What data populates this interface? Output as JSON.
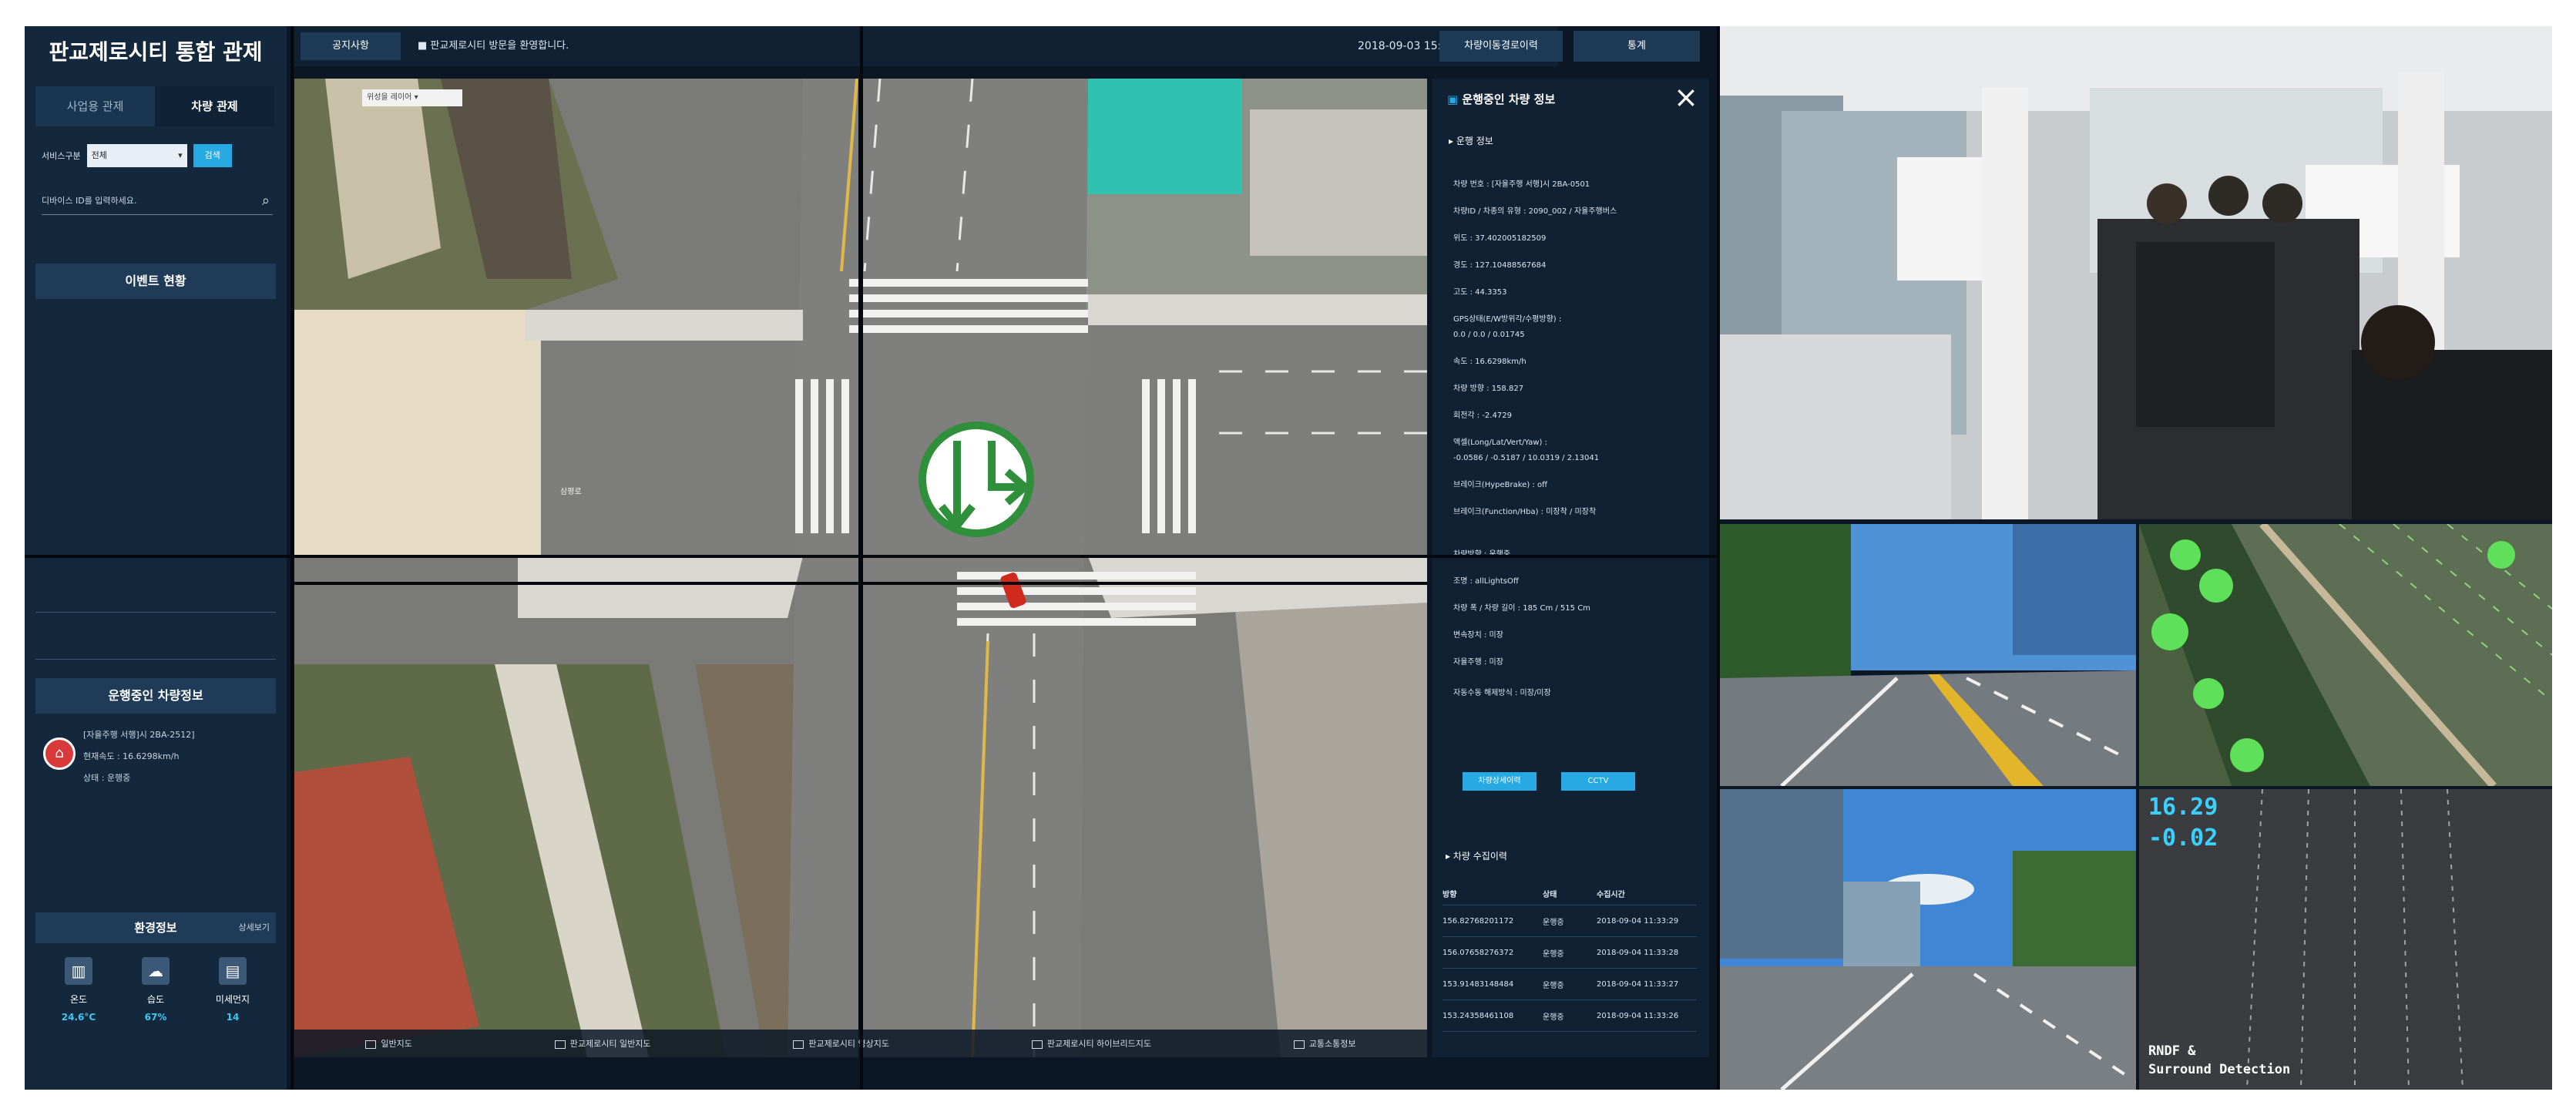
{
  "app": {
    "title": "판교제로시티 통합 관제"
  },
  "left": {
    "tabs": [
      {
        "label": "사업용 관제"
      },
      {
        "label": "차량 관제"
      }
    ],
    "service_label": "서비스구분",
    "service_value": "전체",
    "service_button": "검색",
    "search_placeholder": "디바이스 ID를 입력하세요.",
    "event_header": "이벤트 현황",
    "vehicle_header": "운행중인 차량정보",
    "vehicle": {
      "name": "[자율주행 서행]시 2BA-2512]",
      "speed": "현재속도 : 16.6298km/h",
      "status": "상태 : 운행중"
    },
    "env": {
      "header": "환경정보",
      "more": "상세보기",
      "items": [
        {
          "label": "온도",
          "value": "24.6°C",
          "icon": "thermometer-icon"
        },
        {
          "label": "습도",
          "value": "67%",
          "icon": "cloud-icon"
        },
        {
          "label": "미세먼지",
          "value": "14",
          "icon": "dust-icon"
        }
      ]
    }
  },
  "topbar": {
    "notice_label": "공지사항",
    "notice_text": "판교제로시티 방문을 환영합니다.",
    "timestamp": "2018-09-03 15:28:10",
    "buttons": [
      {
        "label": "차량이동경로이력"
      },
      {
        "label": "통계"
      }
    ]
  },
  "map": {
    "dropdown": "위성을 레이어",
    "road_label": "삼평로",
    "bottom_layers": [
      {
        "label": "일반지도"
      },
      {
        "label": "판교제로시티 일반지도"
      },
      {
        "label": "판교제로시티 영상지도"
      },
      {
        "label": "판교제로시티 하이브리드지도"
      },
      {
        "label": "교통소통정보"
      }
    ]
  },
  "vehicle_panel": {
    "title": "운행중인 차량 정보",
    "section": "운행 정보",
    "fields": [
      {
        "text": "차량 번호 : [자율주행 서행]시 2BA-0501"
      },
      {
        "text": "차량ID / 차종의 유형 : 2090_002 / 자율주행버스"
      },
      {
        "text": "위도 : 37.402005182509"
      },
      {
        "text": "경도 : 127.10488567684"
      },
      {
        "text": "고도 : 44.3353"
      },
      {
        "text": "GPS상태(E/W방위각/수평방향) :"
      },
      {
        "text": "0.0 / 0.0 / 0.01745"
      },
      {
        "text": "속도 : 16.6298km/h"
      },
      {
        "text": "차량 방향 : 158.827"
      },
      {
        "text": "회전각 : -2.4729"
      },
      {
        "text": "액셀(Long/Lat/Vert/Yaw) :"
      },
      {
        "text": "-0.0586 / -0.5187 / 10.0319 / 2.13041"
      },
      {
        "text": "브레이크(HypeBrake) : off"
      },
      {
        "text": "브레이크(Function/Hba) : 미장착 / 미장착"
      },
      {
        "text": "차량방향 : 운행중"
      },
      {
        "text": "조명 : allLightsOff"
      },
      {
        "text": "차량 폭 / 차량 길이 : 185 Cm / 515 Cm"
      },
      {
        "text": "변속장치 : 미장"
      },
      {
        "text": "자율주행 : 미장"
      },
      {
        "text": "자동수동 해제방식 : 미장/미장"
      }
    ],
    "buttons": [
      {
        "label": "차량상세이력"
      },
      {
        "label": "CCTV"
      }
    ],
    "history_title": "차량 수집이력",
    "history_headers": {
      "c1": "방향",
      "c2": "상태",
      "c3": "수집시간"
    },
    "history": [
      {
        "heading": "156.82768201172",
        "status": "운행중",
        "time": "2018-09-04 11:33:29"
      },
      {
        "heading": "156.07658276372",
        "status": "운행중",
        "time": "2018-09-04 11:33:28"
      },
      {
        "heading": "153.91483148484",
        "status": "운행중",
        "time": "2018-09-04 11:33:27"
      },
      {
        "heading": "153.24358461108",
        "status": "운행중",
        "time": "2018-09-04 11:33:26"
      }
    ]
  },
  "cameras": {
    "lidar_top": "16.29",
    "lidar_bottom": "-0.02",
    "lidar_caption_1": "RNDF &",
    "lidar_caption_2": "Surround Detection"
  },
  "colors": {
    "accent": "#27a9e1",
    "panel": "#13283d",
    "sign_green": "#2f8f3a"
  }
}
